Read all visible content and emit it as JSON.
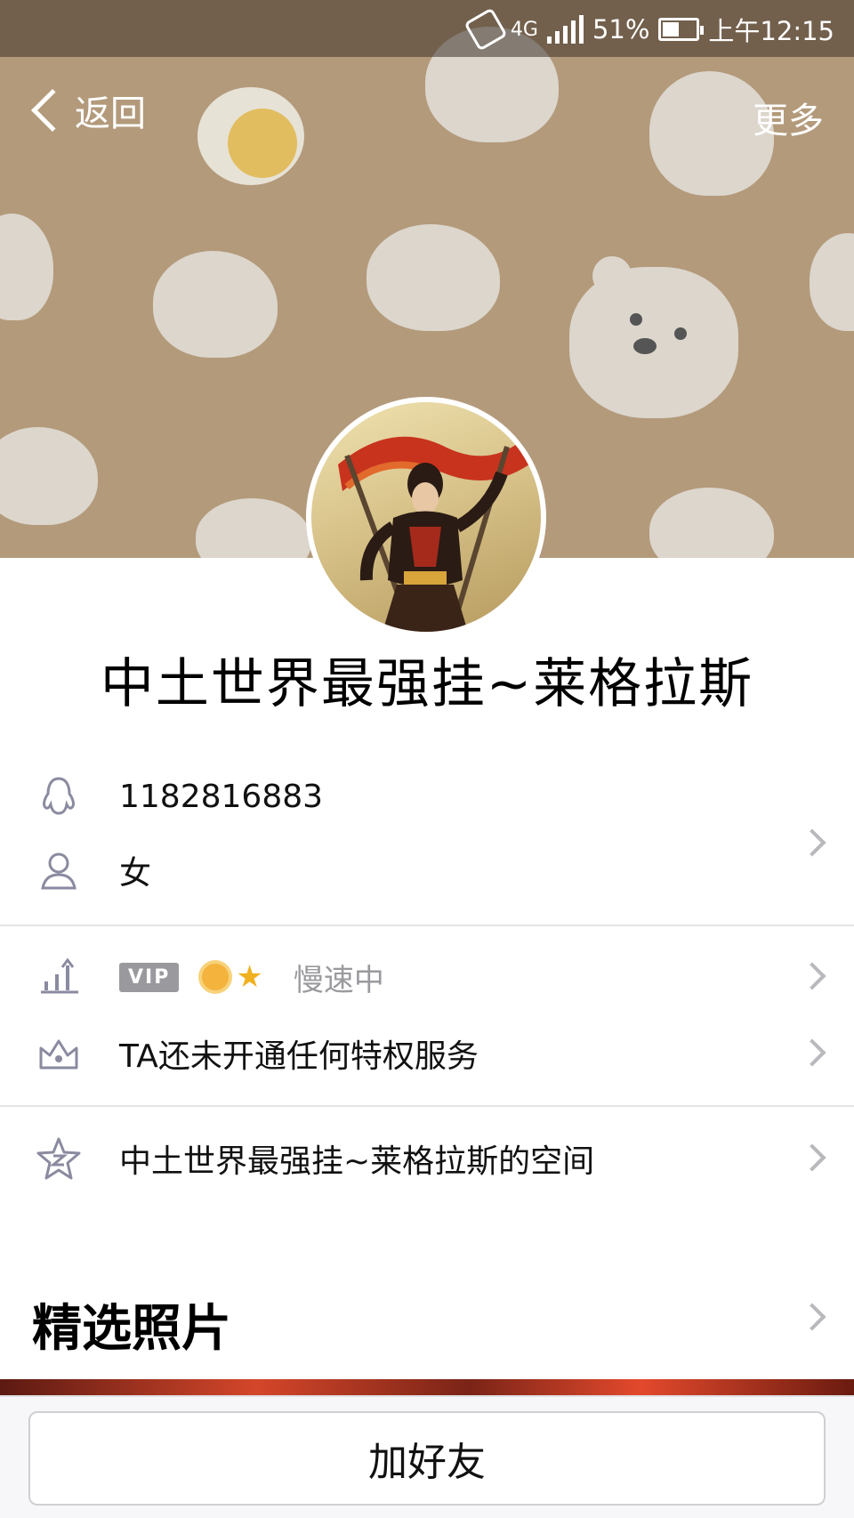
{
  "status_bar": {
    "network": "4G",
    "battery": "51%",
    "time": "上午12:15"
  },
  "nav": {
    "back_label": "返回",
    "more_label": "更多"
  },
  "profile": {
    "name": "中土世界最强挂~莱格拉斯",
    "qq_number": "1182816883",
    "gender": "女"
  },
  "level": {
    "vip_badge": "VIP",
    "speed_status": "慢速中"
  },
  "privilege": {
    "text": "TA还未开通任何特权服务"
  },
  "space": {
    "text": "中土世界最强挂~莱格拉斯的空间"
  },
  "photos": {
    "title": "精选照片"
  },
  "footer": {
    "add_friend_label": "加好友"
  },
  "colors": {
    "cover_bg": "#b39a7b",
    "icon_gray": "#8a8aa0",
    "divider": "#e4e4e6"
  },
  "icons": [
    "back-chevron-icon",
    "penguin-icon",
    "person-icon",
    "level-chart-icon",
    "crown-icon",
    "qzone-star-icon",
    "chevron-right-icon"
  ]
}
